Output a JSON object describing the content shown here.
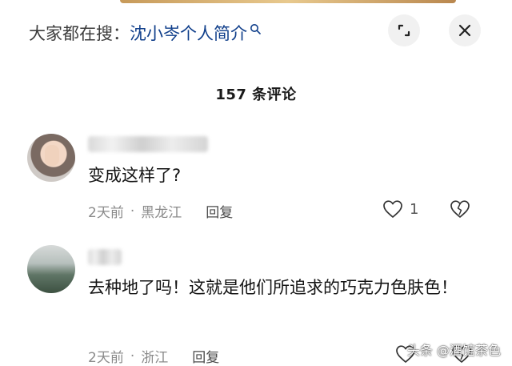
{
  "search": {
    "prefix": "大家都在搜：",
    "query": "沈小岑个人简介",
    "icon": "search-icon"
  },
  "header_buttons": {
    "expand_icon": "expand-icon",
    "close_icon": "close-icon"
  },
  "comments_header": {
    "count_text": "157 条评论"
  },
  "comments": [
    {
      "text": "变成这样了?",
      "time": "2天前",
      "separator": "·",
      "location": "黑龙江",
      "reply_label": "回复",
      "likes": "1"
    },
    {
      "text": "去种地了吗！这就是他们所追求的巧克力色肤色！",
      "time": "2天前",
      "separator": "·",
      "location": "浙江",
      "reply_label": "回复"
    }
  ],
  "watermark": "头条 @酒馆茶色"
}
